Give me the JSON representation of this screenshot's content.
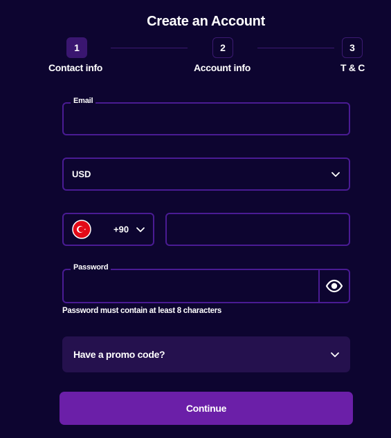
{
  "page_title": "Create an Account",
  "stepper": {
    "steps": [
      {
        "number": "1",
        "label": "Contact info",
        "state": "active"
      },
      {
        "number": "2",
        "label": "Account info",
        "state": "inactive"
      },
      {
        "number": "3",
        "label": "T & C",
        "state": "inactive"
      }
    ]
  },
  "email": {
    "label": "Email",
    "value": ""
  },
  "currency": {
    "selected": "USD",
    "icon": "chevron-down-icon"
  },
  "phone": {
    "country_flag": "turkey-flag-icon",
    "country_code": "+90",
    "number_value": ""
  },
  "password": {
    "label": "Password",
    "value": "",
    "toggle_icon": "eye-icon",
    "hint": "Password must contain at least 8 characters"
  },
  "promo": {
    "label": "Have a promo code?",
    "icon": "chevron-down-icon"
  },
  "continue_label": "Continue",
  "colors": {
    "background": "#0d0530",
    "field_border": "#4a1b94",
    "active_step": "#3a1670",
    "promo_bg": "#25114e",
    "primary_button": "#6b1fa8",
    "text": "#ffffff"
  }
}
